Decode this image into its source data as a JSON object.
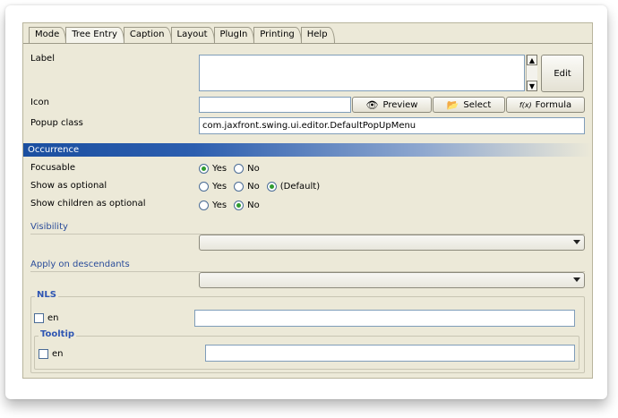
{
  "tabs": [
    "Mode",
    "Tree Entry",
    "Caption",
    "Layout",
    "PlugIn",
    "Printing",
    "Help"
  ],
  "active_tab": "Tree Entry",
  "fields": {
    "label": "Label",
    "icon": "Icon",
    "popup_class": "Popup class",
    "popup_class_value": "com.jaxfront.swing.ui.editor.DefaultPopUpMenu",
    "label_value": "",
    "icon_value": ""
  },
  "buttons": {
    "edit": "Edit",
    "preview": "Preview",
    "select": "Select",
    "formula": "Formula",
    "formula_prefix": "f(x)"
  },
  "occurrence": {
    "title": "Occurrence",
    "focusable": {
      "label": "Focusable",
      "options": [
        "Yes",
        "No"
      ],
      "selected": "Yes"
    },
    "show_optional": {
      "label": "Show as optional",
      "options": [
        "Yes",
        "No",
        "(Default)"
      ],
      "selected": "(Default)"
    },
    "show_children_optional": {
      "label": "Show children as optional",
      "options": [
        "Yes",
        "No"
      ],
      "selected": "No"
    }
  },
  "visibility": {
    "label": "Visibility",
    "value": ""
  },
  "apply_descendants": {
    "label": "Apply on descendants",
    "value": ""
  },
  "nls": {
    "title": "NLS",
    "lang": "en",
    "value": "",
    "tooltip": {
      "title": "Tooltip",
      "lang": "en",
      "value": ""
    }
  },
  "colors": {
    "section_bar": "#1b4fa0",
    "panel_bg": "#ece9d8",
    "legend": "#2f56b3",
    "link": "#2a4c9a"
  }
}
